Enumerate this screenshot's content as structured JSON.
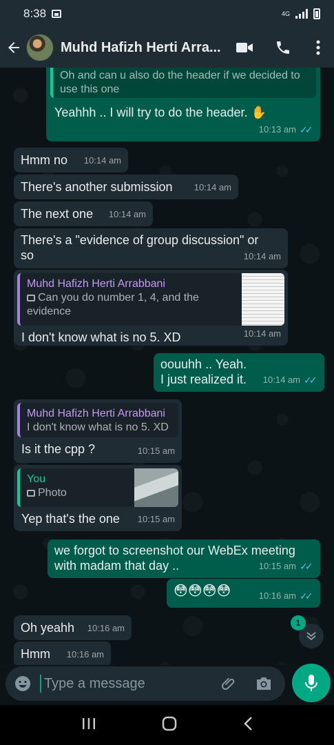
{
  "status": {
    "time": "8:38",
    "network": "4G"
  },
  "header": {
    "contact_name": "Muhd Hafizh Herti Arra..."
  },
  "messages": [
    {
      "quote": "Oh and can u also do the header if we decided to use this one",
      "text": "Yeahhh .. I will try to do the header. ✋",
      "time": "10:13 am"
    },
    {
      "text": "Hmm no",
      "time": "10:14 am"
    },
    {
      "text": "There's another submission",
      "time": "10:14 am"
    },
    {
      "text": "The next one",
      "time": "10:14 am"
    },
    {
      "text": "There's a \"evidence of group discussion\" or so",
      "time": "10:14 am"
    },
    {
      "quote_name": "Muhd Hafizh Herti Arrabbani",
      "quote_text": "Can you do number 1, 4, and the evidence",
      "text": "I don't know what is no 5. XD",
      "time": "10:14 am"
    },
    {
      "text": "oouuhh .. Yeah.\nI just realized it.",
      "time": "10:14 am"
    },
    {
      "quote_name": "Muhd Hafizh Herti Arrabbani",
      "quote_text": "I don't know what is no 5. XD",
      "text": "Is it the cpp ?",
      "time": "10:15 am"
    },
    {
      "quote_name": "You",
      "quote_text": "Photo",
      "text": "Yep that's the one",
      "time": "10:15 am"
    },
    {
      "text": "we forgot to screenshot our WebEx meeting with madam that day ..",
      "time": "10:15 am"
    },
    {
      "text": "😳😳😳😳",
      "time": "10:16 am"
    },
    {
      "text": "Oh yeahh",
      "time": "10:16 am"
    },
    {
      "text": "Hmm",
      "time": "10:16 am"
    }
  ],
  "scroll_badge": "1",
  "composer": {
    "placeholder": "Type a message"
  },
  "colors": {
    "accent": "#00a884",
    "outgoing": "#005c4b",
    "incoming": "#1f2c34",
    "read_ticks": "#53bdeb"
  },
  "icons": [
    "back-arrow-icon",
    "video-call-icon",
    "phone-icon",
    "more-vert-icon",
    "emoji-icon",
    "attach-icon",
    "camera-icon",
    "mic-icon",
    "chevron-down-icon",
    "nav-recents-icon",
    "nav-home-icon",
    "nav-back-icon"
  ]
}
